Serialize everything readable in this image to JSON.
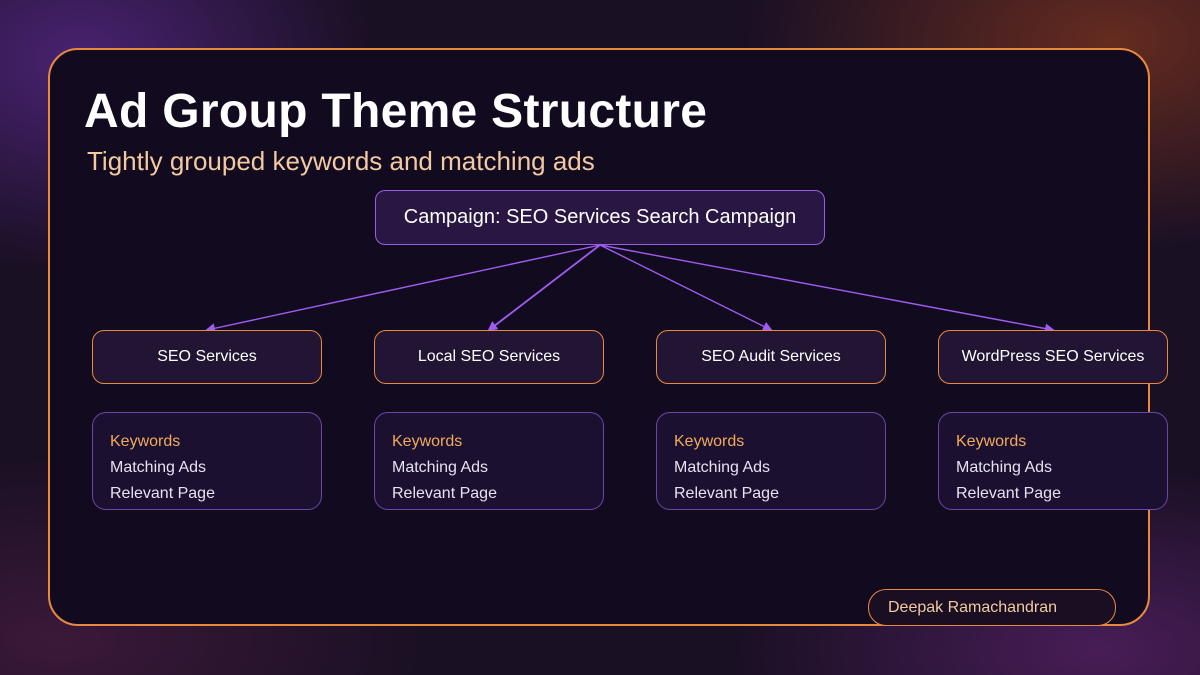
{
  "slide": {
    "title": "Ad Group Theme Structure",
    "subtitle": "Tightly grouped keywords and matching ads",
    "author": "Deepak Ramachandran"
  },
  "campaign": {
    "label": "Campaign: SEO Services Search Campaign"
  },
  "ad_groups": [
    {
      "label": "SEO Services",
      "details": [
        "Keywords",
        "Matching Ads",
        "Relevant Page"
      ]
    },
    {
      "label": "Local SEO Services",
      "details": [
        "Keywords",
        "Matching Ads",
        "Relevant Page"
      ]
    },
    {
      "label": "SEO Audit Services",
      "details": [
        "Keywords",
        "Matching Ads",
        "Relevant Page"
      ]
    },
    {
      "label": "WordPress SEO Services",
      "details": [
        "Keywords",
        "Matching Ads",
        "Relevant Page"
      ]
    }
  ],
  "colors": {
    "accent_orange": "#e8893e",
    "accent_purple": "#9a5fe0",
    "keyword_text": "#f2aa5c",
    "subtitle_text": "#f2c9a2"
  }
}
